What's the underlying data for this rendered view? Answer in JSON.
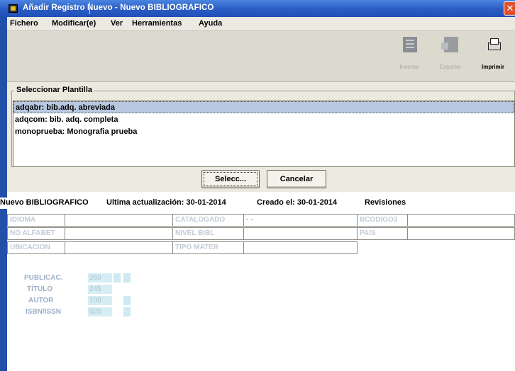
{
  "window": {
    "title": "Añadir Registro Nuevo - Nuevo BIBLIOGRAFICO",
    "close_glyph": "✕"
  },
  "menu": {
    "items": [
      "Fichero",
      "Modificar(e)",
      "Ver",
      "Herramientas",
      "Ayuda"
    ]
  },
  "toolbar": {
    "insert_label": "Insertar",
    "export_label": "Exportar",
    "print_label": "Imprimir"
  },
  "template_panel": {
    "title": "Seleccionar Plantilla",
    "items": [
      "adqabr:  bib.adq. abreviada",
      "adqcom:  bib. adq. completa",
      "monoprueba:  Monografia prueba"
    ],
    "selected_index": 0,
    "select_button": "Selecc...",
    "cancel_button": "Cancelar"
  },
  "record_info": {
    "type": "Nuevo BIBLIOGRAFICO",
    "last_update": "Ultima actualización: 30-01-2014",
    "created": "Creado el: 30-01-2014",
    "revisions": "Revisiones"
  },
  "fixed_fields": {
    "idioma": "IDIOMA",
    "catalogado": "CATALOGADO",
    "catalogado_value": "- -",
    "bcodigo3": "BCODIGO3",
    "no_alfabet": "NO ALFABET",
    "nivel_bibl": "NIVEL BIBL",
    "pais": "PAIS",
    "ubicacion": "UBICACION",
    "tipo_mater": "TIPO MATER"
  },
  "variable_fields": [
    {
      "label": "PUBLICAC.",
      "tag": "260"
    },
    {
      "label": "TÍTULO",
      "tag": "245"
    },
    {
      "label": "AUTOR",
      "tag": "100"
    },
    {
      "label": "ISBN/ISSN",
      "tag": "020"
    }
  ],
  "colors": {
    "title_bar": "#2a5cc4",
    "close_button": "#e0502a",
    "selection": "#b8c8e0",
    "field_label": "#9cb0c8",
    "tag_fill": "#d4eef4"
  },
  "icons": {
    "app": "app-icon",
    "insert": "insert-icon",
    "export": "export-icon",
    "print": "printer-icon",
    "close": "close-icon"
  }
}
